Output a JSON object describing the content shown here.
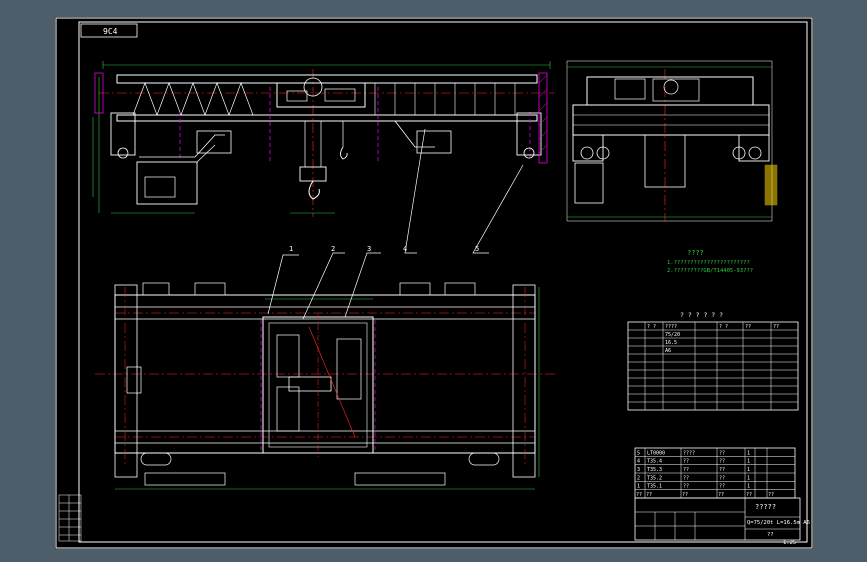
{
  "title_tab": "9C4",
  "callouts": [
    "1",
    "2",
    "3",
    "4",
    "5"
  ],
  "tech_notes": {
    "heading": "????",
    "lines": [
      "1.???????????????????????",
      "2.?????????GB/T14405-93???"
    ]
  },
  "param_table": {
    "heading": "? ? ? ? ? ?",
    "header": [
      "",
      "? ?",
      "????",
      "",
      "? ?",
      "??",
      "??"
    ],
    "rows": [
      [
        "",
        "",
        "75/20",
        "",
        "",
        "",
        ""
      ],
      [
        "",
        "",
        "16.5",
        "",
        "",
        "",
        ""
      ],
      [
        "",
        "",
        "A6",
        "",
        "",
        "",
        ""
      ],
      [
        "",
        "",
        "",
        "",
        "",
        "",
        ""
      ],
      [
        "",
        "",
        "",
        "",
        "",
        "",
        ""
      ],
      [
        "",
        "",
        "",
        "",
        "",
        "",
        ""
      ],
      [
        "",
        "",
        "",
        "",
        "",
        "",
        ""
      ],
      [
        "",
        "",
        "",
        "",
        "",
        "",
        ""
      ],
      [
        "",
        "",
        "",
        "",
        "",
        "",
        ""
      ],
      [
        "",
        "",
        "",
        "",
        "",
        "",
        ""
      ]
    ]
  },
  "parts_list": {
    "rows": [
      [
        "5",
        "LT0000",
        "????",
        "??",
        "1",
        "",
        ""
      ],
      [
        "4",
        "T35.4",
        "??",
        "??",
        "1",
        "",
        ""
      ],
      [
        "3",
        "T35.3",
        "??",
        "??",
        "1",
        "",
        ""
      ],
      [
        "2",
        "T35.2",
        "??",
        "??",
        "1",
        "",
        ""
      ],
      [
        "1",
        "T35.1",
        "??",
        "??",
        "1",
        "",
        ""
      ]
    ],
    "header": [
      "??",
      "??",
      "??",
      "??",
      "??",
      "",
      "??"
    ]
  },
  "title_block": {
    "name": "?????",
    "spec": "Q=75/20t  L=16.5m  A6",
    "sheet_no": "??",
    "scale": "1:25"
  },
  "colors": {
    "background": "#4e5d6a",
    "sheet": "#000000",
    "frame": "#ffffff",
    "drawing": "#ffffff",
    "centerline": "#ff2a2a",
    "dimension": "#2ecc40",
    "hidden": "#ff00ff",
    "accent": "#ffd400"
  }
}
